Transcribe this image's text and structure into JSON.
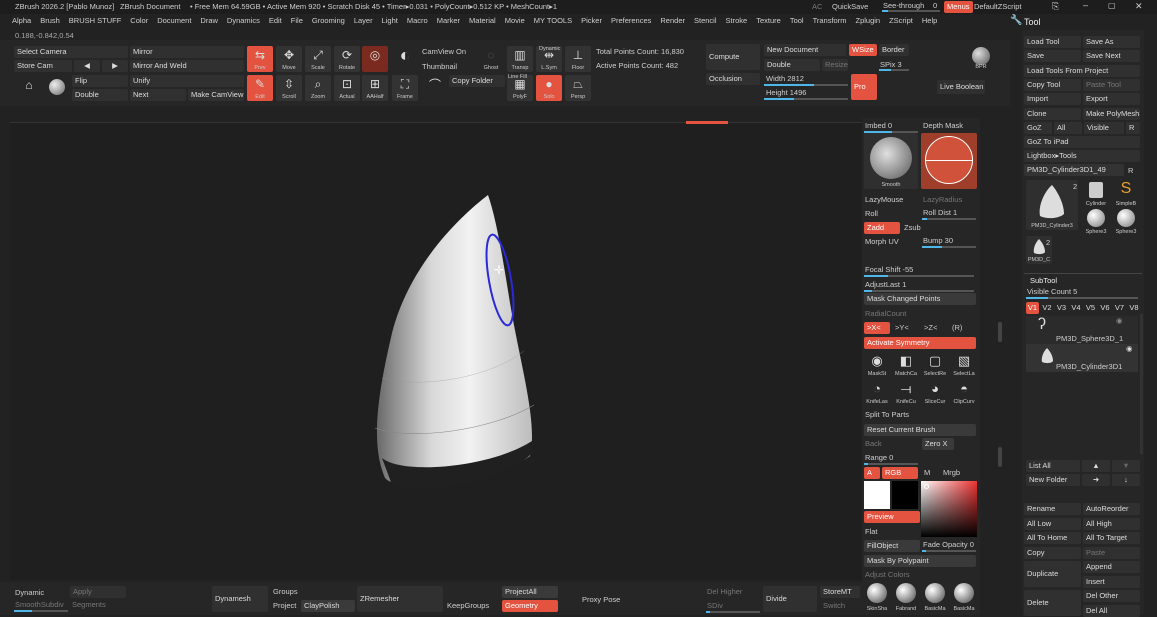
{
  "title_bar": {
    "app": "ZBrush 2026.2 [Pablo Munoz]",
    "doc": "ZBrush Document",
    "stats": "• Free Mem 64.59GB • Active Mem 920 • Scratch Disk 45 • Timer▸0.031 • PolyCount▸0.512 KP • MeshCount▸1",
    "ac": "AC",
    "quicksave": "QuickSave",
    "see_through": "See-through",
    "see_through_val": "0",
    "menus": "Menus",
    "default_script": "DefaultZScript"
  },
  "menu_bar": [
    "Alpha",
    "Brush",
    "BRUSH STUFF",
    "Color",
    "Document",
    "Draw",
    "Dynamics",
    "Edit",
    "File",
    "Grooming",
    "Layer",
    "Light",
    "Macro",
    "Marker",
    "Material",
    "Movie",
    "MY TOOLS",
    "Picker",
    "Preferences",
    "Render",
    "Stencil",
    "Stroke",
    "Texture",
    "Tool",
    "Transform",
    "Zplugin",
    "ZScript",
    "Help"
  ],
  "coords": "0.188,-0.842,0.54",
  "top_shelf": {
    "select_camera": "Select Camera",
    "mirror": "Mirror",
    "store_cam": "Store Cam",
    "mirror_weld": "Mirror And Weld",
    "flip": "Flip",
    "unify": "Unify",
    "double": "Double",
    "next": "Next",
    "make_camview": "Make CamView",
    "prev": "Prev",
    "move": "Move",
    "scale": "Scale",
    "rotate": "Rotate",
    "edit": "Edit",
    "scroll": "Scroll",
    "zoom": "Zoom",
    "actual": "Actual",
    "aahalf": "AAHalf",
    "frame": "Frame",
    "camview_on": "CamView On",
    "thumbnail": "Thumbnail",
    "copy_folder": "Copy Folder",
    "ghost": "Ghost",
    "transp": "Transp",
    "dynamic": "Dynamic",
    "lsym": "L.Sym",
    "floor": "Floor",
    "line_fill": "Line Fill",
    "polyf": "PolyF",
    "solo": "Solo",
    "persp": "Persp",
    "total_points": "Total Points Count: 16,830",
    "active_points": "Active Points Count: 482",
    "compute": "Compute",
    "occlusion": "Occlusion",
    "new_document": "New Document",
    "wsize": "WSize",
    "border": "Border",
    "double2": "Double",
    "resize": "Resize",
    "spix": "SPix 3",
    "width": "Width 2812",
    "height": "Height 1496",
    "pro": "Pro",
    "bpr": "BPR",
    "live_boolean": "Live Boolean"
  },
  "right_tray": {
    "imbed": "Imbed 0",
    "depth_mask": "Depth Mask",
    "smooth": "Smooth",
    "lazymouse": "LazyMouse",
    "lazyradius": "LazyRadius",
    "roll": "Roll",
    "roll_dist": "Roll Dist 1",
    "zadd": "Zadd",
    "zsub": "Zsub",
    "morph_uv": "Morph UV",
    "bump": "Bump 30",
    "focal_shift": "Focal Shift -55",
    "adjust_last": "AdjustLast 1",
    "mask_changed": "Mask Changed Points",
    "radial_count": "RadialCount",
    "x_sym": ">X<",
    "y_sym": ">Y<",
    "z_sym": ">Z<",
    "r_sym": "(R)",
    "activate_symmetry": "Activate Symmetry",
    "tools_row1": [
      "MaskSt",
      "MatchCa",
      "SelectRe",
      "SelectLa"
    ],
    "tools_row2": [
      "KnifeLas",
      "KnifeCu",
      "SliceCur",
      "ClipCurv"
    ],
    "split_to_parts": "Split To Parts",
    "reset_brush": "Reset Current Brush",
    "back": "Back",
    "zero_x": "Zero X",
    "range": "Range 0",
    "a": "A",
    "rgb": "RGB",
    "m": "M",
    "mrgb": "Mrgb",
    "preview": "Preview",
    "flat": "Flat",
    "fill_object": "FillObject",
    "fade_opacity": "Fade Opacity 0",
    "mask_polypaint": "Mask By Polypaint",
    "adjust_colors": "Adjust Colors",
    "materials": [
      "SkinSha",
      "Fabrand",
      "BasicMa",
      "BasicMa"
    ]
  },
  "tool_panel": {
    "header": "Tool",
    "load_tool": "Load Tool",
    "save_as": "Save As",
    "save": "Save",
    "save_next": "Save Next",
    "load_from_project": "Load Tools From Project",
    "copy_tool": "Copy Tool",
    "paste_tool": "Paste Tool",
    "import": "Import",
    "export": "Export",
    "clone": "Clone",
    "make_polymesh": "Make PolyMesh3D",
    "goz": "GoZ",
    "all": "All",
    "visible": "Visible",
    "r": "R",
    "goz_ipad": "GoZ To iPad",
    "lightbox_tools": "Lightbox▸Tools",
    "current_tool": "PM3D_Cylinder3D1_49",
    "current_tool_r": "R",
    "thumb_count": "2",
    "thumb_labels": [
      "PM3D_Cylinder3",
      "Cylinder",
      "SimpleB",
      "Sphere3",
      "Sphere3"
    ],
    "thumb_small": "PM3D_C",
    "thumb_small_count": "2",
    "subtool_header": "SubTool",
    "visible_count": "Visible Count 5",
    "versions": [
      "V1",
      "V2",
      "V3",
      "V4",
      "V5",
      "V6",
      "V7",
      "V8"
    ],
    "subtool_items": [
      "PM3D_Sphere3D_1",
      "PM3D_Cylinder3D1"
    ],
    "list_all": "List All",
    "new_folder": "New Folder",
    "rename": "Rename",
    "auto_reorder": "AutoReorder",
    "all_low": "All Low",
    "all_high": "All High",
    "all_to_home": "All To Home",
    "all_to_target": "All To Target",
    "copy": "Copy",
    "paste": "Paste",
    "duplicate": "Duplicate",
    "append": "Append",
    "insert": "Insert",
    "delete": "Delete",
    "del_other": "Del Other",
    "del_all": "Del All"
  },
  "bottom_bar": {
    "dynamic": "Dynamic",
    "apply": "Apply",
    "smooth_subdiv": "SmoothSubdiv",
    "segments": "Segments",
    "dynamesh": "Dynamesh",
    "groups": "Groups",
    "project": "Project",
    "claypolish": "ClayPolish",
    "zremesher": "ZRemesher",
    "keepgroups": "KeepGroups",
    "project_all": "ProjectAll",
    "geometry": "Geometry",
    "proxy_pose": "Proxy Pose",
    "del_higher": "Del Higher",
    "sdiv": "SDiv",
    "divide": "Divide",
    "store_mt": "StoreMT",
    "switch": "Switch"
  },
  "colors": {
    "accent": "#e3533f",
    "slider": "#4fb7e8",
    "gizmo": "#2a2ad8"
  }
}
